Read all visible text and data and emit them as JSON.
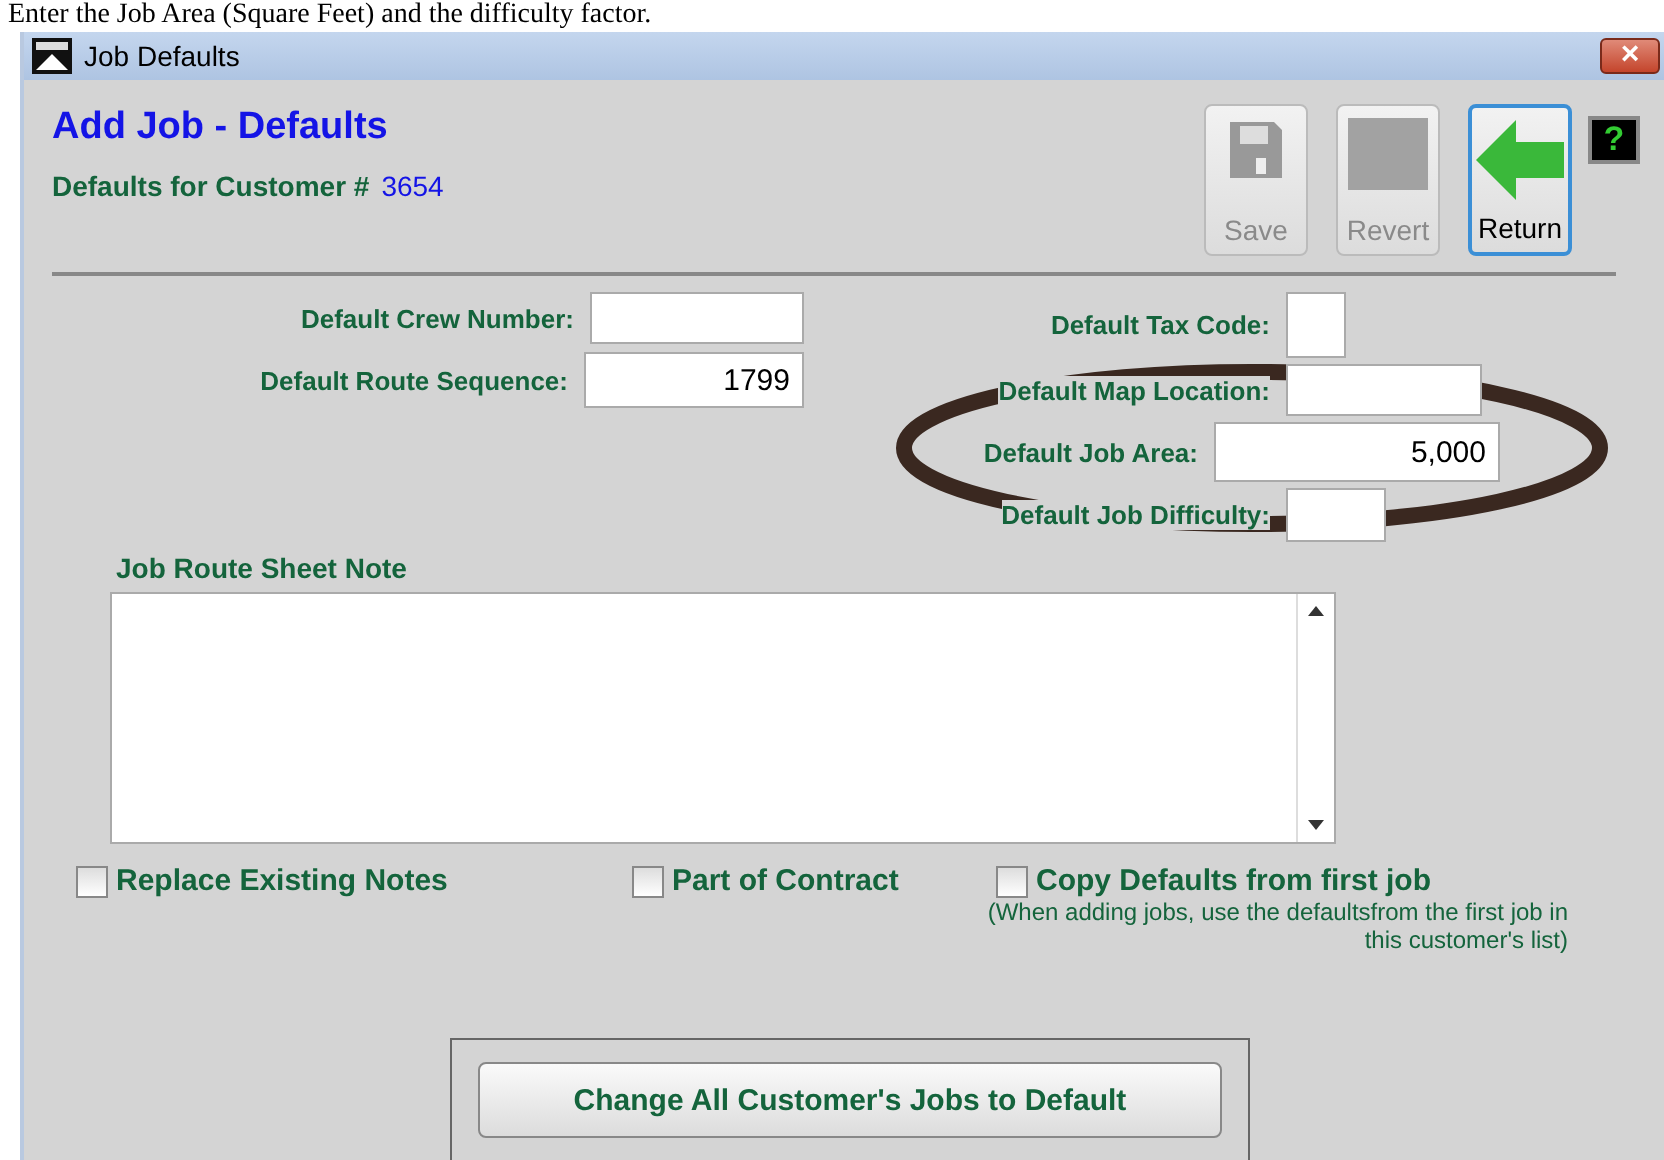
{
  "caption": "Enter the Job Area (Square Feet) and the difficulty factor.",
  "window": {
    "title": "Job Defaults",
    "close": "×"
  },
  "header": {
    "title": "Add Job - Defaults",
    "customer_label": "Defaults for Customer #",
    "customer_number": "3654"
  },
  "toolbar": [
    {
      "kind": "save",
      "label": "Save",
      "disabled": true
    },
    {
      "kind": "revert",
      "label": "Revert",
      "disabled": true
    },
    {
      "kind": "return",
      "label": "Return",
      "disabled": false
    }
  ],
  "help": "?",
  "left_fields": [
    {
      "label": "Default Crew Number:"
    },
    {
      "label": "Default Route Sequence:",
      "value": "1799"
    }
  ],
  "right_fields": [
    {
      "label": "Default Tax Code:"
    },
    {
      "label": "Default Map Location:"
    },
    {
      "label": "Default Job Area:",
      "value": "5,000"
    },
    {
      "label": "Default Job Difficulty:"
    }
  ],
  "note": {
    "label": "Job Route Sheet Note"
  },
  "checkboxes": [
    {
      "label": "Replace Existing Notes",
      "checked": false
    },
    {
      "label": "Part of Contract",
      "checked": false
    },
    {
      "label": "Copy Defaults from first job",
      "checked": false,
      "hint": "(When adding jobs, use the defaultsfrom the first job in this customer's list)"
    }
  ],
  "action_button": "Change All Customer's Jobs to Default",
  "annotation": {
    "kind": "ellipse"
  }
}
